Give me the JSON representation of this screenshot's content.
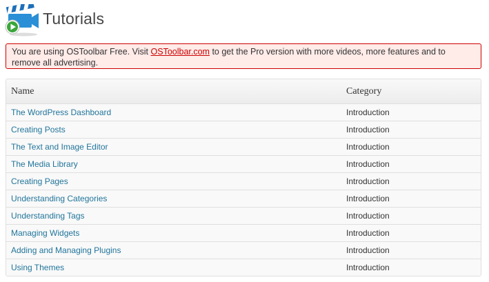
{
  "header": {
    "title": "Tutorials",
    "logo_icon": "video-camera-play-icon"
  },
  "notice": {
    "text_before": "You are using OSToolbar Free. Visit ",
    "link_text": "OSToolbar.com",
    "text_after": " to get the Pro version with more videos, more features and to remove all advertising."
  },
  "table": {
    "columns": [
      "Name",
      "Category"
    ],
    "rows": [
      {
        "name": "The WordPress Dashboard",
        "category": "Introduction"
      },
      {
        "name": "Creating Posts",
        "category": "Introduction"
      },
      {
        "name": "The Text and Image Editor",
        "category": "Introduction"
      },
      {
        "name": "The Media Library",
        "category": "Introduction"
      },
      {
        "name": "Creating Pages",
        "category": "Introduction"
      },
      {
        "name": "Understanding Categories",
        "category": "Introduction"
      },
      {
        "name": "Understanding Tags",
        "category": "Introduction"
      },
      {
        "name": "Managing Widgets",
        "category": "Introduction"
      },
      {
        "name": "Adding and Managing Plugins",
        "category": "Introduction"
      },
      {
        "name": "Using Themes",
        "category": "Introduction"
      }
    ]
  },
  "colors": {
    "link": "#21759b",
    "notice_bg": "#ffebe8",
    "notice_border": "#cc0000",
    "logo_blue": "#2a8fd6",
    "logo_green": "#3aa63a"
  }
}
